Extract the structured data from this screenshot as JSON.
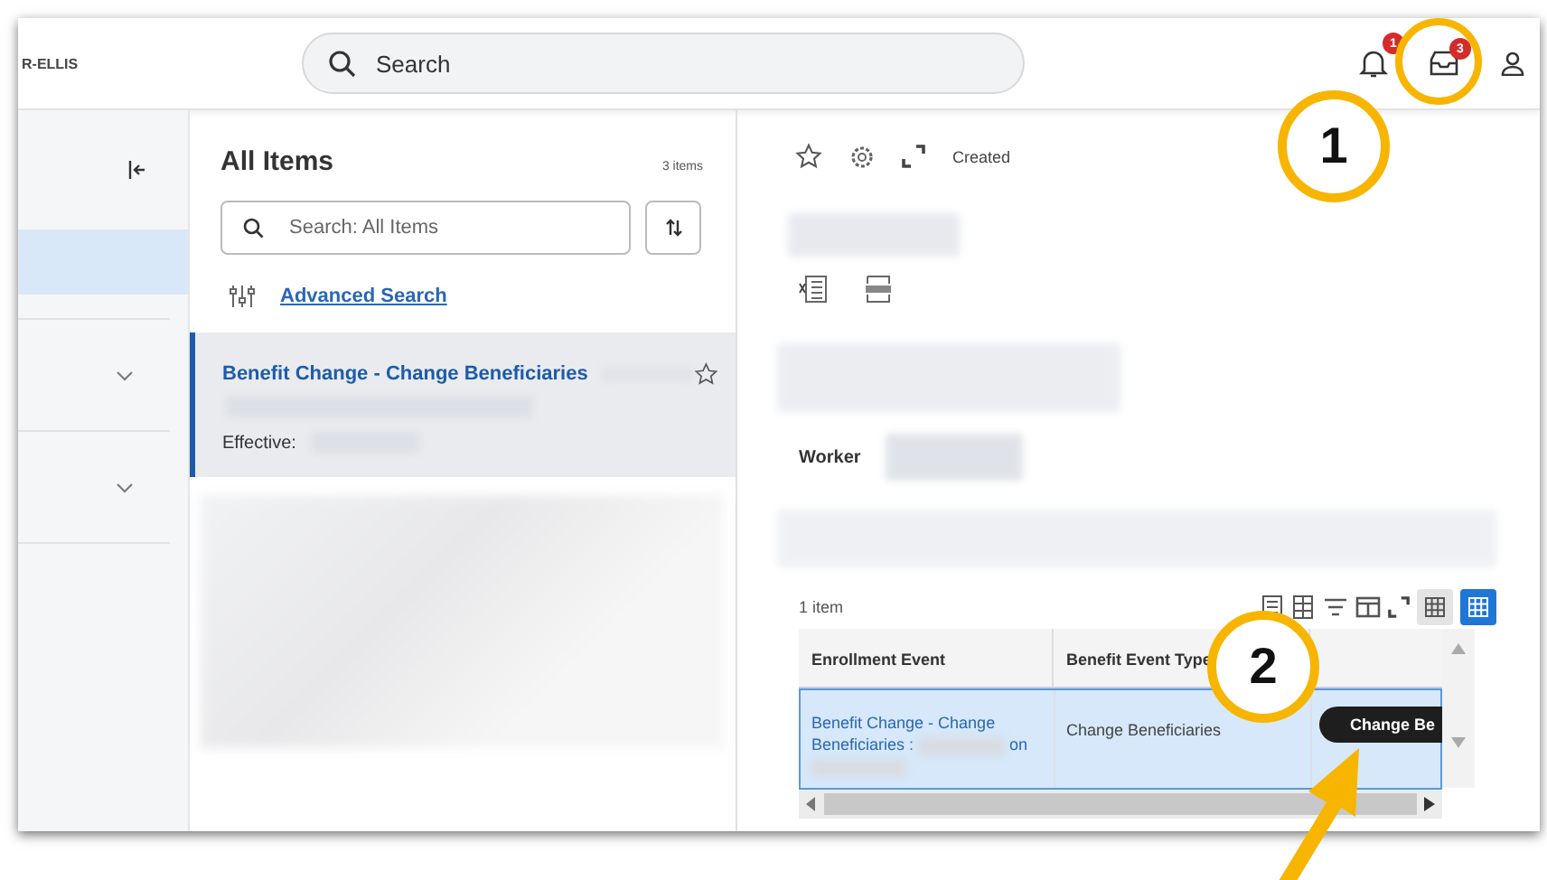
{
  "header": {
    "logo": "R-ELLIS",
    "search": {
      "placeholder": "Search"
    },
    "notifications_badge": "1",
    "inbox_badge": "3"
  },
  "sidebar": {
    "items": [
      {
        "kind": "link",
        "selected": true
      },
      {
        "kind": "group",
        "selected": false,
        "expanded": false
      },
      {
        "kind": "group",
        "selected": false,
        "expanded": false
      },
      {
        "kind": "link",
        "selected": false
      }
    ]
  },
  "list": {
    "title": "All Items",
    "count": "3 items",
    "search": {
      "placeholder": "Search: All Items"
    },
    "advanced_search": "Advanced Search",
    "items": [
      {
        "title": "Benefit Change - Change Beneficiaries",
        "label": "Effective:",
        "selected": true
      }
    ]
  },
  "detail": {
    "toolbar_label": "Created",
    "worker_label": "Worker",
    "table": {
      "count": "1 item",
      "views": [
        {
          "selected": false
        },
        {
          "selected": true
        }
      ],
      "columns": [
        "Enrollment Event",
        "Benefit Event Type"
      ],
      "rows": [
        {
          "selected": true,
          "event_parts": [
            "Benefit Change - Change Beneficiaries :",
            "on"
          ],
          "type": "Change Beneficiaries",
          "action": "Change Be"
        }
      ]
    }
  },
  "callouts": [
    {
      "label": "1"
    },
    {
      "label": "2"
    }
  ]
}
